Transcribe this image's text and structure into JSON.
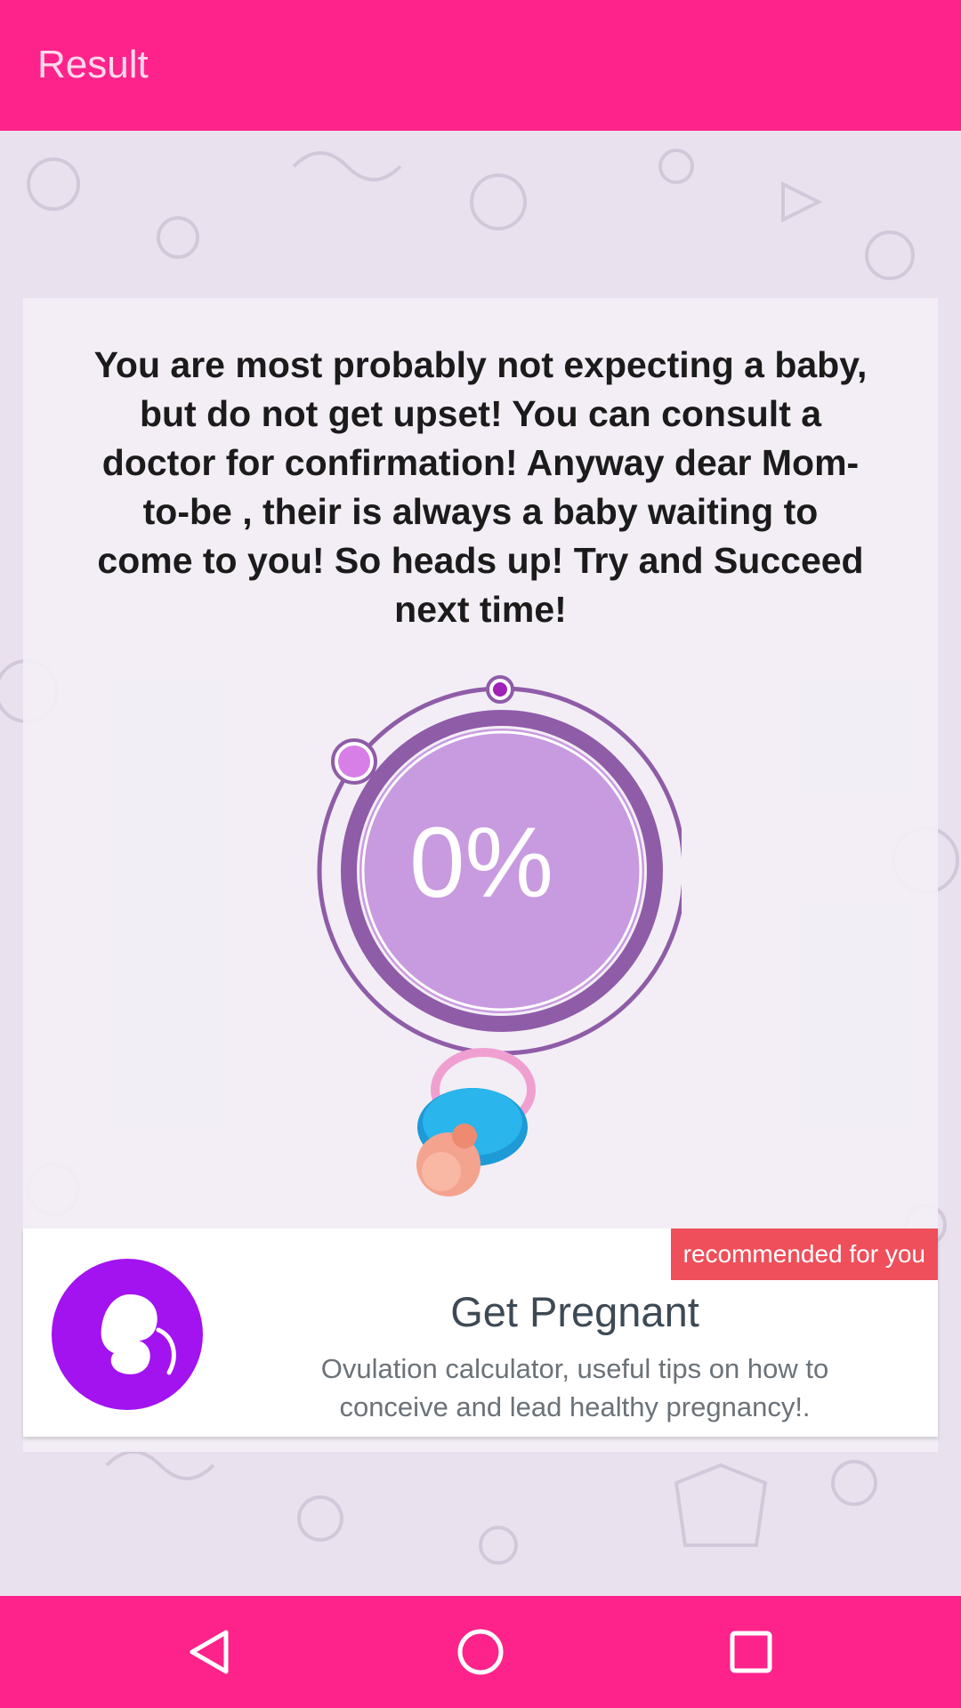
{
  "app_bar": {
    "title": "Result"
  },
  "result": {
    "message": "You are most probably not expecting a baby,\nbut do not get upset! You can  consult a\ndoctor for confirmation! Anyway dear Mom-\nto-be , their is always a baby waiting to\ncome to you! So heads up! Try and Succeed\nnext time!",
    "percent": "0%",
    "probability_value": 0
  },
  "promo": {
    "badge": "recommended for you",
    "title": "Get Pregnant",
    "description": "Ovulation calculator, useful tips on how to conceive and lead healthy pregnancy!.",
    "logo_icon": "fetus-icon"
  },
  "nav_bar": {
    "back_icon": "back-triangle-icon",
    "home_icon": "home-circle-icon",
    "recents_icon": "recents-square-icon"
  },
  "colors": {
    "accent": "#fd238b",
    "gauge_fill": "#c89ae0",
    "gauge_ring": "#8f5ca8",
    "badge": "#ef4f5a",
    "promo_logo": "#a213f0"
  }
}
